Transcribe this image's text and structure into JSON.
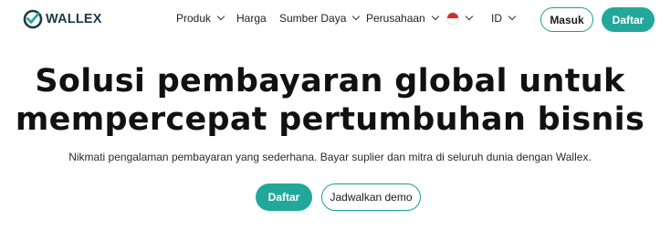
{
  "brand": {
    "name": "WALLEX",
    "accent": "#22a89a"
  },
  "nav": {
    "items": [
      {
        "label": "Produk",
        "has_dropdown": true
      },
      {
        "label": "Harga",
        "has_dropdown": false
      },
      {
        "label": "Sumber Daya",
        "has_dropdown": true
      },
      {
        "label": "Perusahaan",
        "has_dropdown": true
      }
    ],
    "language": {
      "flag": "indonesia-flag-icon",
      "code": "ID"
    },
    "login_label": "Masuk",
    "signup_label": "Daftar"
  },
  "hero": {
    "headline_line1": "Solusi pembayaran global untuk",
    "headline_line2": "mempercepat pertumbuhan bisnis",
    "subtitle": "Nikmati pengalaman pembayaran yang sederhana. Bayar suplier dan mitra di seluruh dunia dengan Wallex.",
    "primary_cta": "Daftar",
    "secondary_cta": "Jadwalkan demo"
  }
}
